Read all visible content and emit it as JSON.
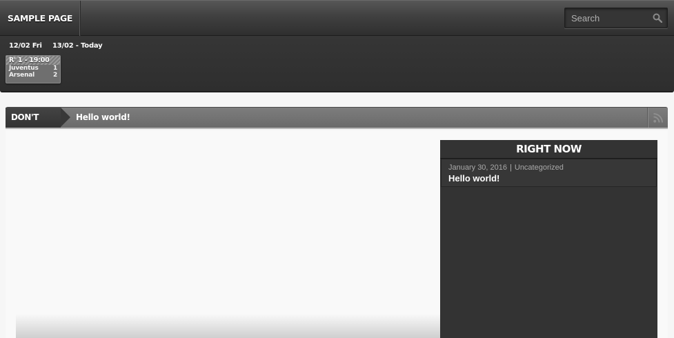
{
  "nav": {
    "items": [
      {
        "label": "SAMPLE PAGE"
      }
    ],
    "search": {
      "placeholder": "Search"
    }
  },
  "scores": {
    "dates": [
      {
        "label": "12/02 Fri"
      },
      {
        "label": "13/02 - Today"
      }
    ],
    "matches": [
      {
        "header": "R' 1 - 19:00",
        "teams": [
          {
            "name": "Juventus",
            "score": "1"
          },
          {
            "name": "Arsenal",
            "score": "2"
          }
        ]
      }
    ]
  },
  "ticker": {
    "label": "DON'T MISS",
    "headline": "Hello world!",
    "rss_icon": "rss-icon"
  },
  "right_now": {
    "title": "RIGHT NOW",
    "posts": [
      {
        "date": "January 30, 2016",
        "separator": "|",
        "category": "Uncategorized",
        "title": "Hello world!"
      }
    ]
  },
  "colors": {
    "header_bg": "#3b3b3b",
    "ticker_bg": "#757575",
    "sidebar_bg": "#333333",
    "page_bg": "#f9f9f9"
  }
}
